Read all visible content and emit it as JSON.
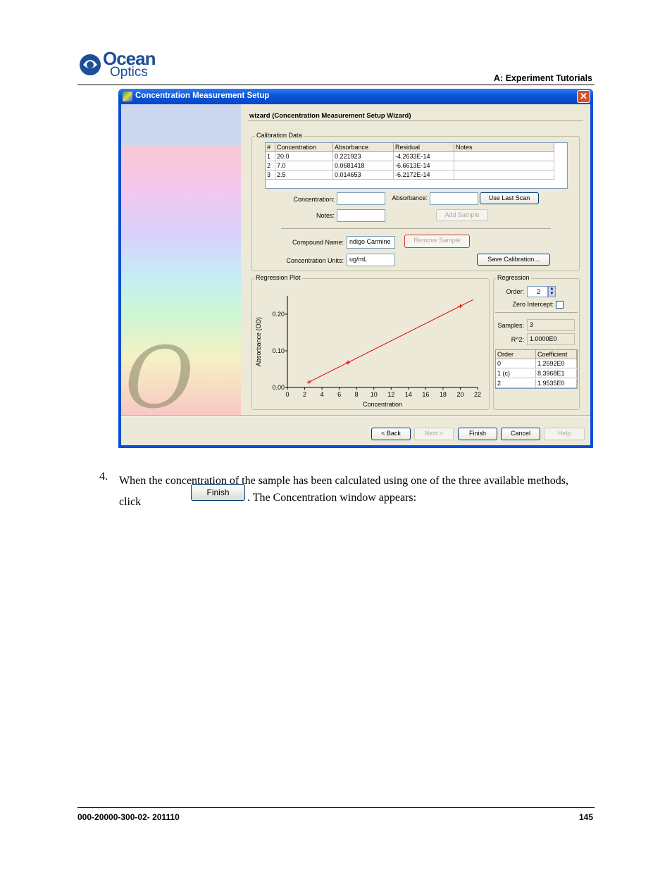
{
  "header": {
    "brand_line1": "Ocean",
    "brand_line2": "Optics",
    "section": "A: Experiment Tutorials"
  },
  "dialog": {
    "title": "Concentration Measurement Setup",
    "close_glyph": "✕",
    "side_mark": "O",
    "wizard_title": "wizard (Concentration Measurement Setup Wizard)",
    "calibration": {
      "label": "Calibration Data",
      "columns": [
        "#",
        "Concentration",
        "Absorbance",
        "Residual",
        "Notes"
      ],
      "rows": [
        [
          "1",
          "20.0",
          "0.221923",
          "-4.2633E-14",
          ""
        ],
        [
          "2",
          "7.0",
          "0.0681418",
          "-6.6613E-14",
          ""
        ],
        [
          "3",
          "2.5",
          "0.014653",
          "-6.2172E-14",
          ""
        ]
      ]
    },
    "form": {
      "concentration_label": "Concentration:",
      "concentration_value": "",
      "absorbance_label": "Absorbance:",
      "absorbance_value": "",
      "use_last_scan": "Use Last Scan",
      "notes_label": "Notes:",
      "notes_value": "",
      "add_sample": "Add Sample",
      "compound_label": "Compound Name:",
      "compound_value": "ndigo Carmine",
      "remove_sample": "Remove Sample",
      "units_label": "Concentration Units:",
      "units_value": "ug/mL",
      "save_calibration": "Save Calibration..."
    },
    "regression_plot": {
      "label": "Regression Plot"
    },
    "regression": {
      "label": "Regression",
      "order_label": "Order:",
      "order_value": "2",
      "zero_intercept_label": "Zero Intercept:",
      "zero_intercept_checked": false,
      "samples_label": "Samples:",
      "samples_value": "3",
      "r2_label": "R^2:",
      "r2_value": "1.0000E0",
      "coef_columns": [
        "Order",
        "Coefficient"
      ],
      "coef_rows": [
        [
          "0",
          "1.2692E0"
        ],
        [
          "1 (c)",
          "8.3968E1"
        ],
        [
          "2",
          "1.9535E0"
        ]
      ]
    },
    "buttons": {
      "back": "< Back",
      "next": "Next >",
      "finish": "Finish",
      "cancel": "Cancel",
      "help": "Help"
    }
  },
  "chart_data": {
    "type": "line",
    "title": "",
    "xlabel": "Concentration",
    "ylabel": "Absorbance (OD)",
    "x_ticks": [
      "0",
      "2",
      "4",
      "6",
      "8",
      "10",
      "12",
      "14",
      "16",
      "18",
      "20",
      "22"
    ],
    "y_ticks": [
      "0.00",
      "0.10",
      "0.20"
    ],
    "xlim": [
      0,
      22
    ],
    "ylim": [
      0,
      0.25
    ],
    "series": [
      {
        "values": [
          [
            2.5,
            0.014653
          ],
          [
            7.0,
            0.0681418
          ],
          [
            20.0,
            0.221923
          ]
        ],
        "color": "#e00000"
      }
    ],
    "fit_line": [
      [
        2.5,
        0.0147
      ],
      [
        21.5,
        0.2398
      ]
    ]
  },
  "step": {
    "number": "4.",
    "text_before": "When the concentration of the sample has been calculated using one of the three available methods, click",
    "button_label": "Finish",
    "text_after": ". The Concentration window appears:"
  },
  "footer": {
    "doc_number": "000-20000-300-02- 201110",
    "page": "145"
  }
}
